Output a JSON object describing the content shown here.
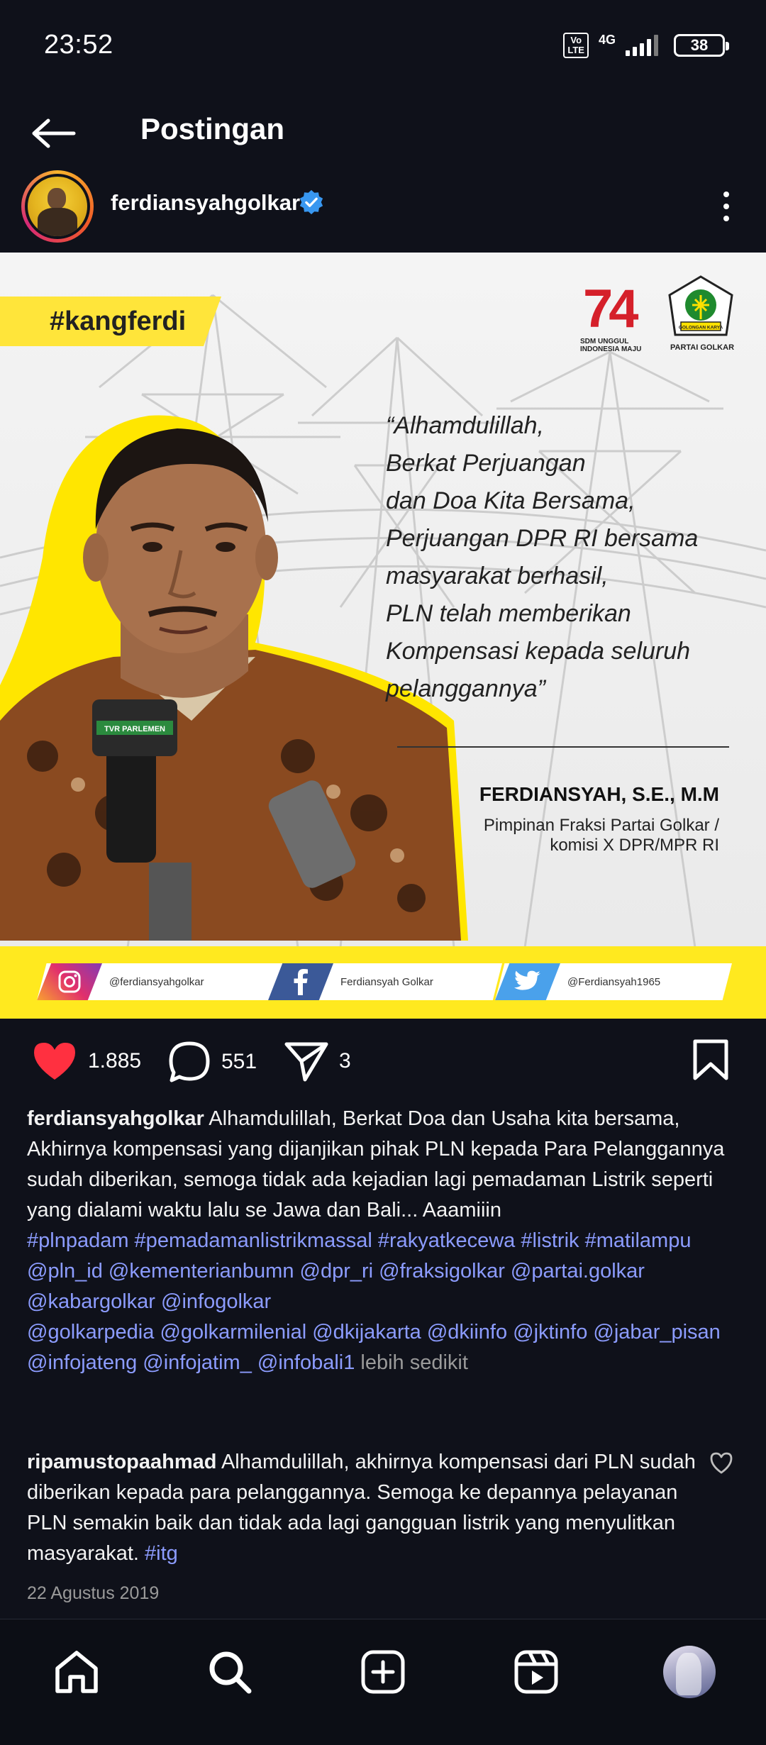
{
  "status_bar": {
    "time": "23:52",
    "volte": "Vo\nLTE",
    "network": "4G",
    "battery": "38",
    "icons": [
      "volte-icon",
      "signal-icon",
      "battery-icon"
    ]
  },
  "header": {
    "title": "Postingan",
    "back_icon": "arrow-left-icon"
  },
  "post": {
    "username": "ferdiansyahgolkar",
    "verified": true,
    "more_icon": "more-vertical-icon",
    "image": {
      "hashtag": "#kangferdi",
      "logo_74_number": "74",
      "logo_74_caption": "SDM UNGGUL\nINDONESIA MAJU",
      "logo_golkar_caption": "PARTAI GOLKAR",
      "golkar_badge_text": "GOLONGAN KARYA",
      "quote": "“Alhamdulillah,\nBerkat Perjuangan\ndan Doa Kita Bersama,\nPerjuangan DPR RI bersama\nmasyarakat berhasil,\nPLN telah memberikan\nKompensasi kepada seluruh\npelanggannya”",
      "speaker_name": "FERDIANSYAH, S.E., M.M",
      "speaker_role": "Pimpinan Fraksi Partai Golkar /\nkomisi X DPR/MPR RI",
      "mic_label": "TVR PARLEMEN",
      "social": [
        {
          "icon": "instagram-icon",
          "label": "@ferdiansyahgolkar",
          "color": "#e1306c"
        },
        {
          "icon": "facebook-icon",
          "label": "Ferdiansyah Golkar",
          "color": "#3b5998"
        },
        {
          "icon": "twitter-icon",
          "label": "@Ferdiansyah1965",
          "color": "#4aa1eb"
        }
      ],
      "accent_color": "#ffe91f"
    },
    "likes": "1.885",
    "comments": "551",
    "shares": "3",
    "caption_text": "Alhamdulillah, Berkat Doa dan Usaha kita bersama, Akhirnya kompensasi yang dijanjikan pihak PLN kepada Para Pelanggannya sudah diberikan, semoga tidak ada kejadian lagi pemadaman Listrik seperti yang dialami waktu lalu se Jawa dan Bali... Aaamiiin",
    "caption_hashtags": "#plnpadam #pemadamanlistrikmassal #rakyatkecewa #listrik #matilampu",
    "caption_mentions_1": "@pln_id @kementerianbumn @dpr_ri @fraksigolkar @partai.golkar @kabargolkar @infogolkar",
    "caption_mentions_2": "@golkarpedia @golkarmilenial @dkijakarta @dkiinfo @jktinfo @jabar_pisan @infojateng @infojatim_ @infobali1",
    "less_label": "lebih sedikit",
    "comment": {
      "username": "ripamustopaahmad",
      "text": "Alhamdulillah, akhirnya kompensasi dari PLN sudah diberikan kepada para pelanggannya. Semoga ke depannya pelayanan PLN semakin baik dan tidak ada lagi gangguan listrik yang menyulitkan masyarakat.",
      "tag": "#itg"
    },
    "date": "22 Agustus 2019"
  },
  "bottom_nav": {
    "items": [
      "home-icon",
      "search-icon",
      "create-icon",
      "reels-icon",
      "profile-avatar"
    ]
  },
  "colors": {
    "background": "#0f111a",
    "link": "#8c9cff",
    "like_red": "#ff3040",
    "verified_blue": "#3897f0"
  }
}
